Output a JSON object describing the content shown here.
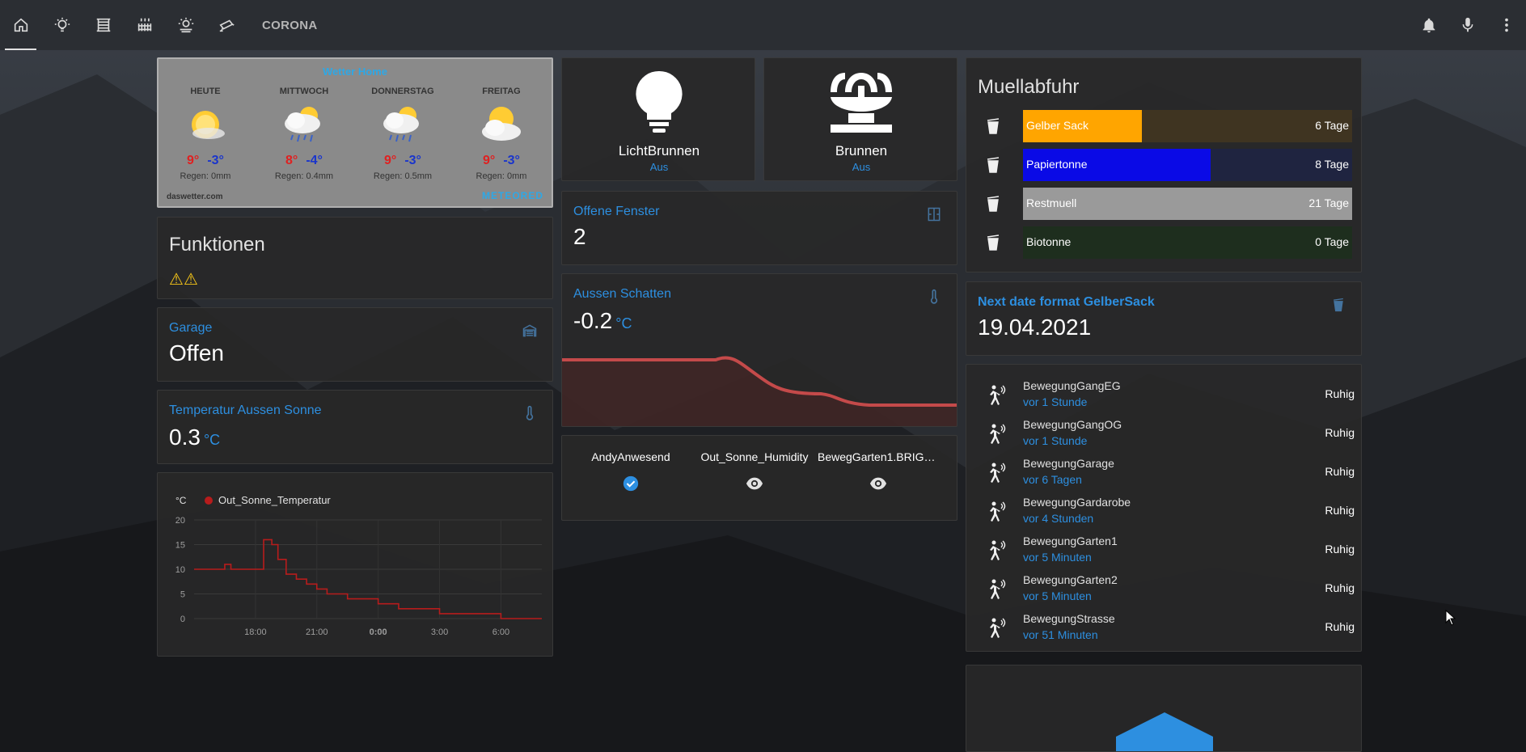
{
  "toolbar": {
    "tabs": [
      {
        "icon": "home-icon"
      },
      {
        "icon": "lightbulb-icon"
      },
      {
        "icon": "blinds-icon"
      },
      {
        "icon": "radiator-icon"
      },
      {
        "icon": "weather-icon"
      },
      {
        "icon": "cctv-icon"
      }
    ],
    "corona_label": "CORONA",
    "right_icons": [
      "bell-icon",
      "microphone-icon",
      "more-vert-icon"
    ]
  },
  "weather": {
    "title": "Wetter Home",
    "days": [
      {
        "name": "HEUTE",
        "hi": "9°",
        "lo": "-3°",
        "rain": "Regen: 0mm",
        "icon": "sunny"
      },
      {
        "name": "MITTWOCH",
        "hi": "8°",
        "lo": "-4°",
        "rain": "Regen: 0.4mm",
        "icon": "rain"
      },
      {
        "name": "DONNERSTAG",
        "hi": "9°",
        "lo": "-3°",
        "rain": "Regen: 0.5mm",
        "icon": "rain"
      },
      {
        "name": "FREITAG",
        "hi": "9°",
        "lo": "-3°",
        "rain": "Regen: 0mm",
        "icon": "partly-cloudy"
      }
    ],
    "source": "daswetter.com",
    "logo": "METEORED"
  },
  "funktionen": {
    "title": "Funktionen",
    "warnings": [
      "⚠",
      "⚠"
    ]
  },
  "garage": {
    "label": "Garage",
    "value": "Offen"
  },
  "temp_sonne": {
    "label": "Temperatur Aussen Sonne",
    "value": "0.3",
    "unit": "°C"
  },
  "chart": {
    "unit_label": "°C",
    "legend": "Out_Sonne_Temperatur",
    "chart_data": {
      "type": "line",
      "title": "",
      "ylabel": "°C",
      "ylim": [
        0,
        20
      ],
      "yticks": [
        "20",
        "15",
        "10",
        "5",
        "0"
      ],
      "xticks": [
        "18:00",
        "21:00",
        "0:00",
        "3:00",
        "6:00"
      ],
      "series": [
        {
          "name": "Out_Sonne_Temperatur",
          "color": "#b71c1c",
          "x": [
            15.0,
            16.0,
            16.5,
            16.8,
            17.0,
            17.5,
            18.0,
            18.4,
            18.8,
            19.1,
            19.5,
            20.0,
            20.5,
            21.0,
            21.5,
            22.0,
            22.5,
            23.0,
            24.0,
            25.0,
            26.0,
            27.0,
            28.0,
            29.0,
            30.0,
            31.0,
            32.0
          ],
          "values": [
            10,
            10,
            11,
            10,
            10,
            10,
            10,
            16,
            15,
            12,
            9,
            8,
            7,
            6,
            5,
            5,
            4,
            4,
            3,
            2,
            2,
            1,
            1,
            1,
            0,
            0,
            0
          ]
        }
      ]
    }
  },
  "licht": {
    "name": "LichtBrunnen",
    "state": "Aus"
  },
  "brunnen": {
    "name": "Brunnen",
    "state": "Aus"
  },
  "fenster": {
    "label": "Offene Fenster",
    "value": "2"
  },
  "schatten": {
    "label": "Aussen Schatten",
    "value": "-0.2",
    "unit": "°C"
  },
  "glance": [
    {
      "name": "AndyAnwesend",
      "icon": "check-circle-icon"
    },
    {
      "name": "Out_Sonne_Humidity",
      "icon": "eye-icon"
    },
    {
      "name": "BewegGarten1.BRIGH...",
      "icon": "eye-icon"
    }
  ],
  "muell": {
    "title": "Muellabfuhr",
    "items": [
      {
        "name": "Gelber Sack",
        "days": "6 Tage",
        "fraction": 0.36,
        "color": "#ffa500",
        "bg": "#3f3421"
      },
      {
        "name": "Papiertonne",
        "days": "8 Tage",
        "fraction": 0.57,
        "color": "#0a0ae6",
        "bg": "#1f2440"
      },
      {
        "name": "Restmuell",
        "days": "21 Tage",
        "fraction": 1.0,
        "color": "#9a9a9a",
        "bg": "#9a9a9a"
      },
      {
        "name": "Biotonne",
        "days": "0 Tage",
        "fraction": 0.0,
        "color": "#1a6b1a",
        "bg": "#1e2e1e"
      }
    ]
  },
  "gelbersack": {
    "label": "Next date format GelberSack",
    "value": "19.04.2021"
  },
  "bewegung": [
    {
      "name": "BewegungGangEG",
      "time": "vor 1 Stunde",
      "state": "Ruhig"
    },
    {
      "name": "BewegungGangOG",
      "time": "vor 1 Stunde",
      "state": "Ruhig"
    },
    {
      "name": "BewegungGarage",
      "time": "vor 6 Tagen",
      "state": "Ruhig"
    },
    {
      "name": "BewegungGardarobe",
      "time": "vor 4 Stunden",
      "state": "Ruhig"
    },
    {
      "name": "BewegungGarten1",
      "time": "vor 5 Minuten",
      "state": "Ruhig"
    },
    {
      "name": "BewegungGarten2",
      "time": "vor 5 Minuten",
      "state": "Ruhig"
    },
    {
      "name": "BewegungStrasse",
      "time": "vor 51 Minuten",
      "state": "Ruhig"
    }
  ]
}
